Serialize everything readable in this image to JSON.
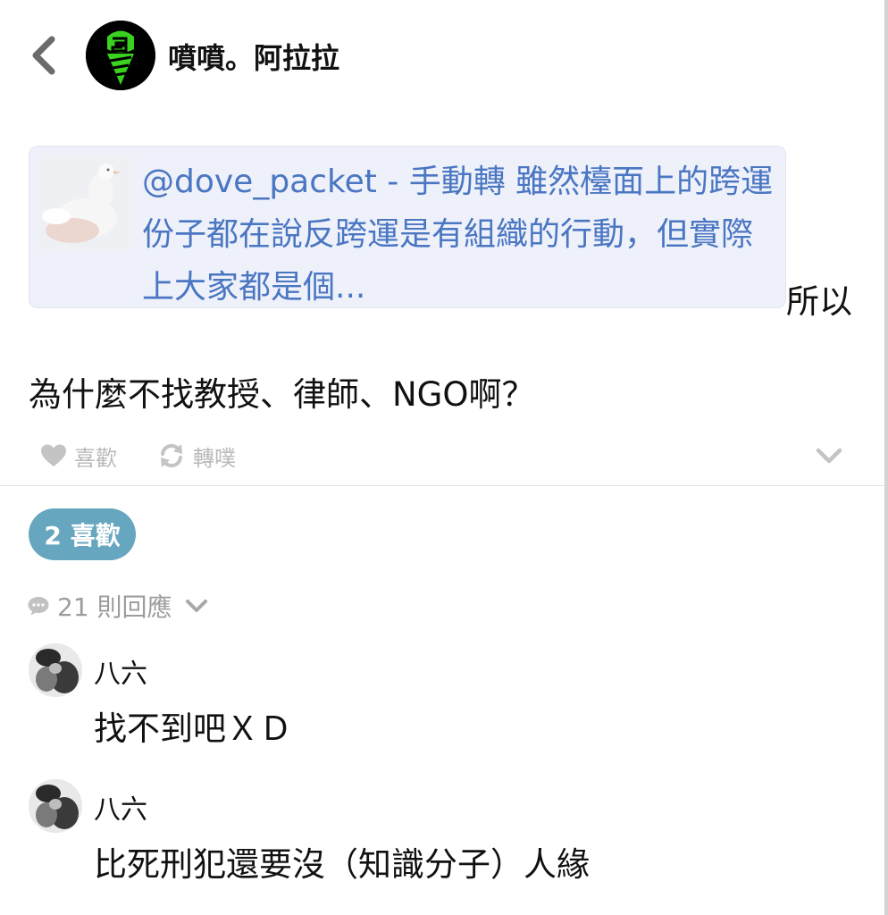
{
  "header": {
    "author_name": "噴噴。阿拉拉"
  },
  "post": {
    "quote": {
      "text": "@dove_packet - 手動轉 雖然檯面上的跨運份子都在說反跨運是有組織的行動，但實際上大家都是個..."
    },
    "inline_after_quote": "所以",
    "body": "為什麼不找教授、律師、NGO啊？"
  },
  "actions": {
    "like_label": "喜歡",
    "replurk_label": "轉噗"
  },
  "likes_badge": "2 喜歡",
  "responses": {
    "count_label": "21 則回應"
  },
  "comments": [
    {
      "author": "八六",
      "text": "找不到吧ＸＤ"
    },
    {
      "author": "八六",
      "text": "比死刑犯還要沒（知識分子）人緣"
    }
  ],
  "colors": {
    "link_blue": "#4a76c2",
    "likes_pill": "#67a6bf",
    "muted_gray": "#b9b9b9",
    "quote_bg": "#eef1fa",
    "logo_green": "#39d21f"
  }
}
